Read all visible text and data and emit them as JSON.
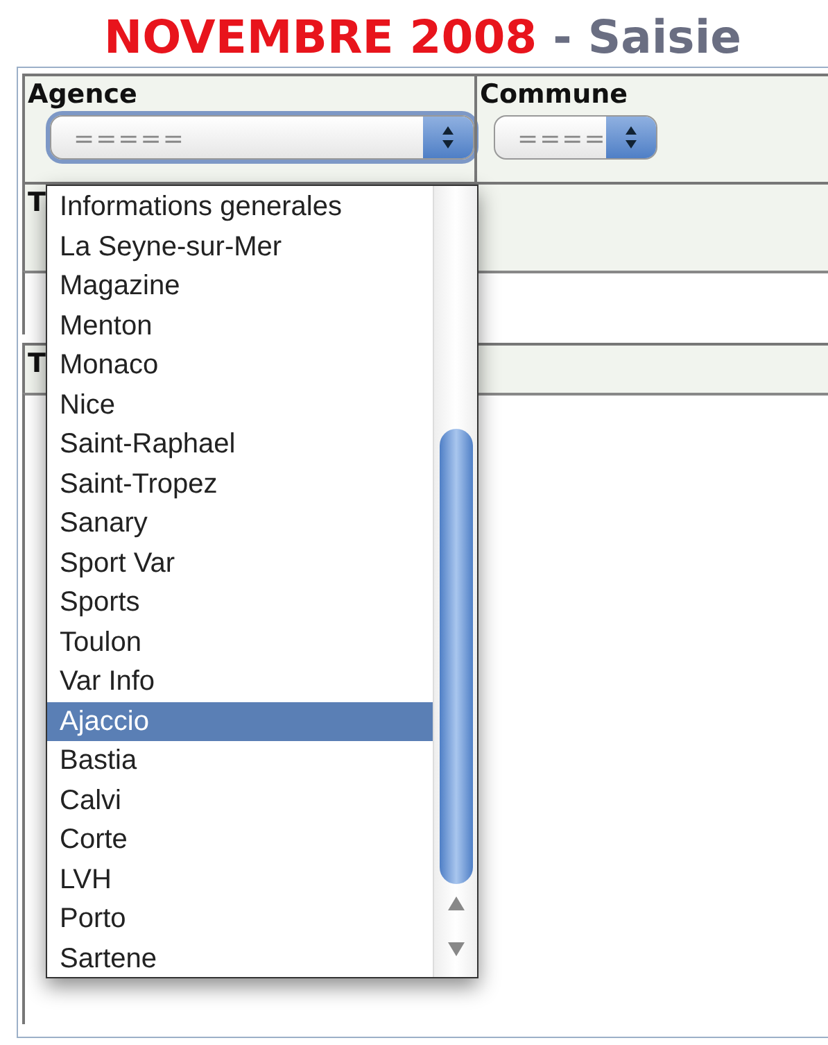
{
  "page_title": {
    "highlight": "NOVEMBRE 2008",
    "rest": " - Saisie"
  },
  "filters": [
    {
      "label": "Agence",
      "value": "=====",
      "focused": true
    },
    {
      "label": "Commune",
      "value": "====",
      "focused": false
    }
  ],
  "fields": [
    {
      "label": "T",
      "kind": "input"
    },
    {
      "label": "T",
      "kind": "textarea"
    }
  ],
  "dropdown": {
    "options": [
      {
        "label": "Informations generales",
        "selected": false
      },
      {
        "label": "La Seyne-sur-Mer",
        "selected": false
      },
      {
        "label": "Magazine",
        "selected": false
      },
      {
        "label": "Menton",
        "selected": false
      },
      {
        "label": "Monaco",
        "selected": false
      },
      {
        "label": "Nice",
        "selected": false
      },
      {
        "label": "Saint-Raphael",
        "selected": false
      },
      {
        "label": "Saint-Tropez",
        "selected": false
      },
      {
        "label": "Sanary",
        "selected": false
      },
      {
        "label": "Sport Var",
        "selected": false
      },
      {
        "label": "Sports",
        "selected": false
      },
      {
        "label": "Toulon",
        "selected": false
      },
      {
        "label": "Var Info",
        "selected": false
      },
      {
        "label": "Ajaccio",
        "selected": true
      },
      {
        "label": "Bastia",
        "selected": false
      },
      {
        "label": "Calvi",
        "selected": false
      },
      {
        "label": "Corte",
        "selected": false
      },
      {
        "label": "LVH",
        "selected": false
      },
      {
        "label": "Porto",
        "selected": false
      },
      {
        "label": "Sartene",
        "selected": false
      }
    ]
  }
}
